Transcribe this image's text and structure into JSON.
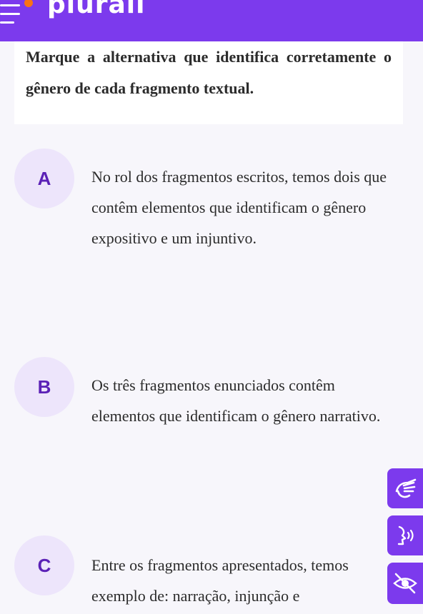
{
  "header": {
    "logo": "plurall",
    "menu_icon": "hamburger-menu-icon",
    "brand_color": "#7c3aed",
    "dot_color": "#f97316"
  },
  "question": {
    "text": "Marque a alternativa que identifica corretamente o gênero de cada fragmento textual."
  },
  "options": [
    {
      "letter": "A",
      "text": "No rol dos fragmentos escritos, temos dois que contêm elementos que identificam o gênero expositivo e um injuntivo."
    },
    {
      "letter": "B",
      "text": "Os três fragmentos enunciados contêm elementos que identificam o gênero narrativo."
    },
    {
      "letter": "C",
      "text": "Entre os fragmentos apresentados, temos exemplo de: narração, injunção e"
    }
  ],
  "accessibility": [
    {
      "icon": "sign-language-icon"
    },
    {
      "icon": "audio-reader-icon"
    },
    {
      "icon": "low-vision-icon"
    }
  ]
}
